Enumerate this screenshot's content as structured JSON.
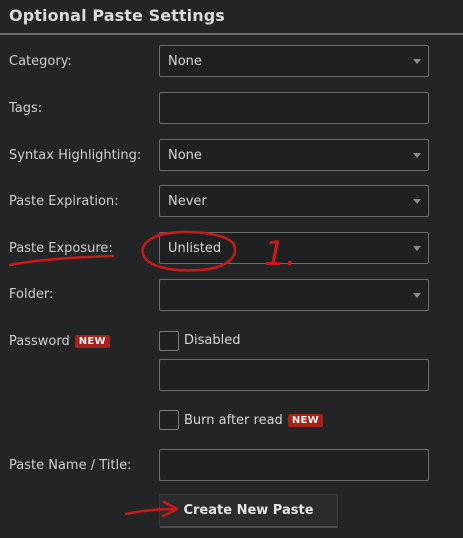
{
  "header": {
    "title": "Optional Paste Settings"
  },
  "category": {
    "label": "Category:",
    "value": "None"
  },
  "tags": {
    "label": "Tags:",
    "value": ""
  },
  "syntax": {
    "label": "Syntax Highlighting:",
    "value": "None"
  },
  "expiration": {
    "label": "Paste Expiration:",
    "value": "Never"
  },
  "exposure": {
    "label": "Paste Exposure:",
    "value": "Unlisted"
  },
  "folder": {
    "label": "Folder:",
    "value": ""
  },
  "password": {
    "label": "Password",
    "badge": "NEW",
    "toggle_label": "Disabled",
    "value": ""
  },
  "burn": {
    "label": "Burn after read",
    "badge": "NEW"
  },
  "paste_name": {
    "label": "Paste Name / Title:",
    "value": ""
  },
  "submit": {
    "label": "Create New Paste"
  },
  "annotation": {
    "text": "1."
  },
  "colors": {
    "background": "#232426",
    "badge": "#a8201a",
    "annotation": "#c81a1a"
  }
}
